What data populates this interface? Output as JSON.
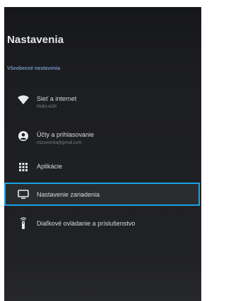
{
  "header": {
    "title": "Nastavenia"
  },
  "section": {
    "label": "Všeobecné nastavenia"
  },
  "items": [
    {
      "label": "Sieť a internet",
      "sub": "PMM-4GR",
      "icon": "wifi-icon"
    },
    {
      "label": "Účty a prihlasovanie",
      "sub": "mizuevinka@gmail.com",
      "icon": "account-icon"
    },
    {
      "label": "Aplikácie",
      "icon": "apps-grid-icon"
    },
    {
      "label": "Nastavenie zariadenia",
      "icon": "tv-icon",
      "selected": true
    },
    {
      "label": "Diaľkové ovládanie a príslušenstvo",
      "icon": "remote-icon"
    }
  ],
  "colors": {
    "focus_border": "#19a3e8",
    "section_text": "#6f93c2",
    "background": "#1c1d21"
  }
}
